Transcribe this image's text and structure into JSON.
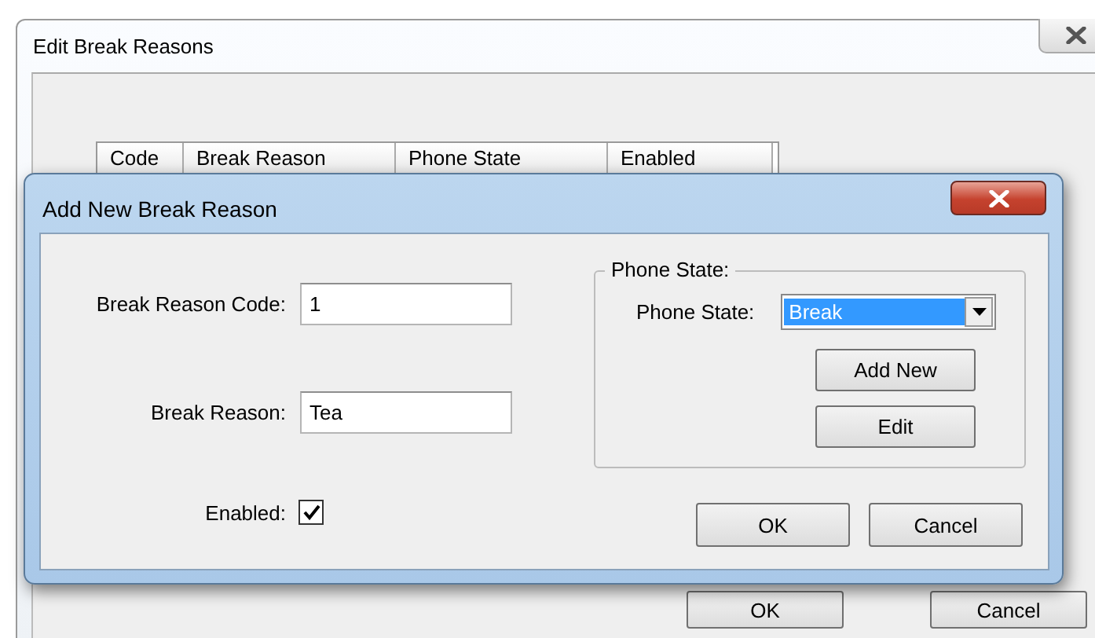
{
  "background_window": {
    "title": "Edit Break Reasons",
    "table": {
      "columns": [
        "Code",
        "Break Reason",
        "Phone State",
        "Enabled"
      ]
    },
    "buttons": [
      "OK",
      "Cancel"
    ]
  },
  "dialog": {
    "title": "Add New Break Reason",
    "fields": [
      {
        "label": "Break Reason Code:",
        "value": "1"
      },
      {
        "label": "Break Reason:",
        "value": "Tea"
      }
    ],
    "enabled": {
      "label": "Enabled:",
      "checked": true
    },
    "group": {
      "title": "Phone State:",
      "label": "Phone State:",
      "value": "Break",
      "buttons": [
        "Add New",
        "Edit"
      ]
    },
    "buttons": [
      "OK",
      "Cancel"
    ]
  }
}
